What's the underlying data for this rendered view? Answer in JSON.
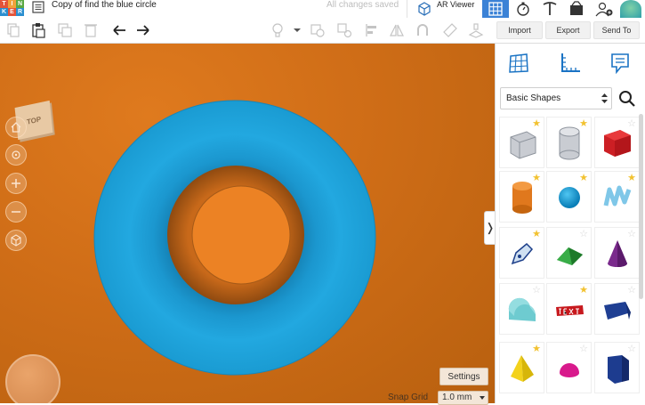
{
  "app": {
    "logo_letters": [
      "T",
      "I",
      "N",
      "K",
      "E",
      "R"
    ],
    "title": "Copy of find the blue circle",
    "save_status": "All changes saved",
    "ar_viewer_label": "AR Viewer"
  },
  "toolbar": {
    "import_label": "Import",
    "export_label": "Export",
    "send_to_label": "Send To"
  },
  "canvas": {
    "viewcube_label": "TOP",
    "settings_label": "Settings",
    "snap_grid_label": "Snap Grid",
    "snap_grid_value": "1.0 mm"
  },
  "library": {
    "selected": "Basic Shapes",
    "shapes": [
      {
        "name": "box-hole-shape",
        "starred": true
      },
      {
        "name": "cylinder-hole-shape",
        "starred": true
      },
      {
        "name": "box-shape",
        "starred": false
      },
      {
        "name": "cylinder-shape",
        "starred": true
      },
      {
        "name": "sphere-shape",
        "starred": true
      },
      {
        "name": "scribble-shape",
        "starred": false
      },
      {
        "name": "shape-generator-pen-shape",
        "starred": true
      },
      {
        "name": "roof-shape",
        "starred": false
      },
      {
        "name": "cone-shape",
        "starred": false
      },
      {
        "name": "round-roof-shape",
        "starred": false
      },
      {
        "name": "text-shape",
        "starred": true
      },
      {
        "name": "wedge-shape",
        "starred": false
      },
      {
        "name": "pyramid-shape",
        "starred": true
      },
      {
        "name": "half-sphere-shape",
        "starred": false
      },
      {
        "name": "polygon-shape",
        "starred": false
      }
    ]
  },
  "colors": {
    "workplane": "#cf6d17",
    "torus": "#1fa3d6",
    "accent_blue": "#3b82d6",
    "star": "#f2c230"
  }
}
